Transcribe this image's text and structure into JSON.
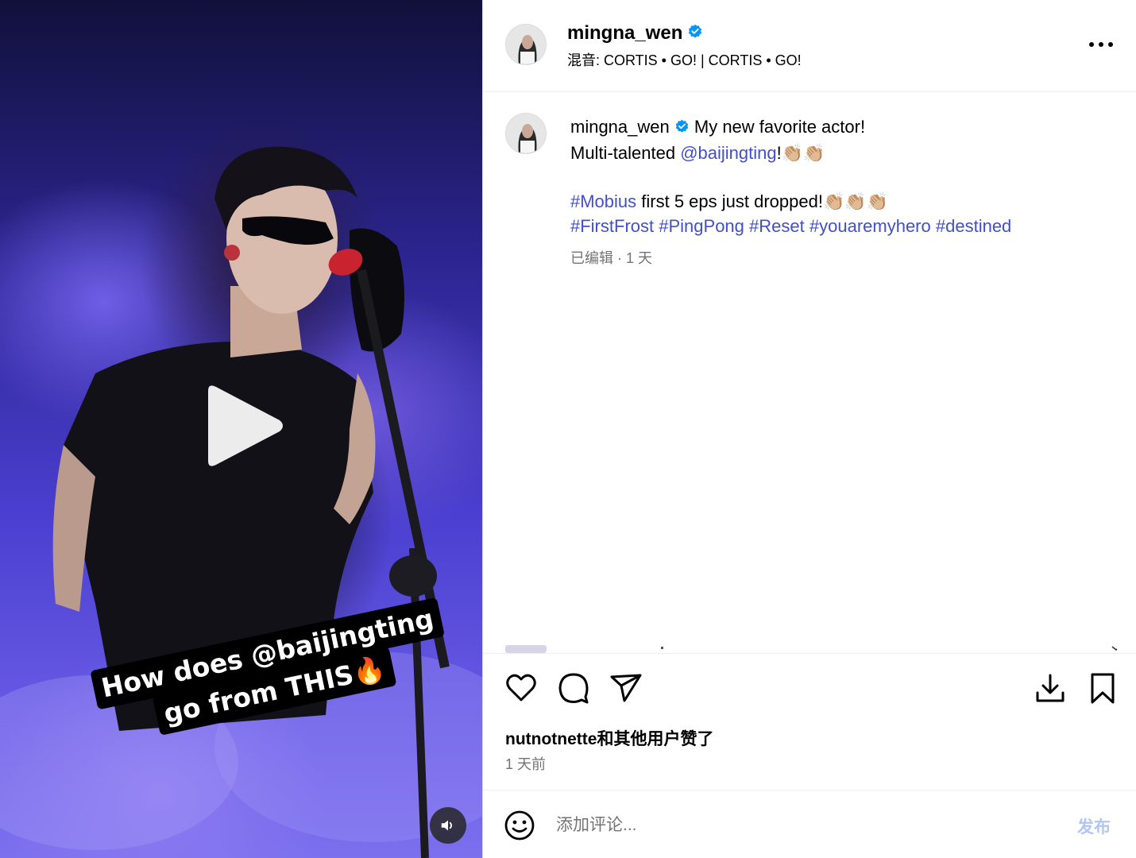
{
  "post": {
    "author": "mingna_wen",
    "music": "混音: CORTIS • GO! | CORTIS • GO!",
    "verified_icon": "verified-badge-icon"
  },
  "video": {
    "overlay_line1": "How does @baijingting",
    "overlay_line2": "go from THIS🔥",
    "play_icon": "play-icon",
    "sound_icon": "speaker-icon"
  },
  "caption": {
    "author": "mingna_wen",
    "text1": "My new favorite actor!",
    "text2_prefix": "Multi-talented ",
    "mention": "@baijingting",
    "text2_suffix": "!👏🏼👏🏼",
    "hashtag_mobius": "#Mobius",
    "text3": " first 5 eps just dropped!👏🏼👏🏼👏🏼",
    "hashtags": [
      "#FirstFrost",
      "#PingPong",
      "#Reset",
      "#youaremyhero",
      "#destined"
    ],
    "meta": "已编辑 · 1 天"
  },
  "actions": {
    "like_icon": "heart-icon",
    "comment_icon": "comment-icon",
    "share_icon": "send-icon",
    "download_icon": "download-icon",
    "save_icon": "bookmark-icon"
  },
  "likes_text": "nutnotnette和其他用户赞了",
  "time_ago": "1 天前",
  "comment_box": {
    "placeholder": "添加评论...",
    "post_label": "发布",
    "emoji_icon": "smiley-icon"
  },
  "colors": {
    "link": "#4150c8",
    "verified": "#0095f6",
    "post_button": "#b2c6f5",
    "muted": "#737373"
  }
}
